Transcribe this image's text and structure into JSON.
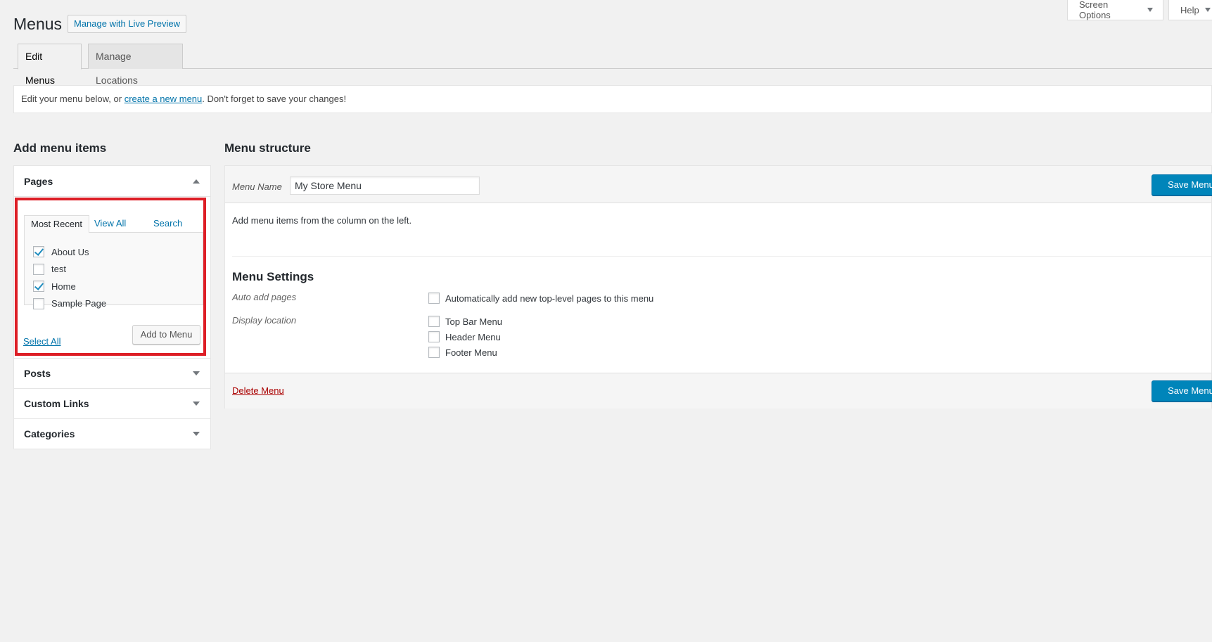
{
  "header": {
    "title": "Menus",
    "live_preview_label": "Manage with Live Preview",
    "screen_options_label": "Screen Options",
    "help_label": "Help"
  },
  "tabs": [
    {
      "label": "Edit Menus",
      "active": true
    },
    {
      "label": "Manage Locations",
      "active": false
    }
  ],
  "notice": {
    "prefix": "Edit your menu below, or ",
    "link": "create a new menu",
    "suffix": ". Don't forget to save your changes!"
  },
  "add_items": {
    "title": "Add menu items",
    "sections": [
      "Pages",
      "Posts",
      "Custom Links",
      "Categories"
    ],
    "pages": {
      "sub_tabs": [
        "Most Recent",
        "View All",
        "Search"
      ],
      "items": [
        {
          "label": "About Us",
          "checked": true
        },
        {
          "label": "test",
          "checked": false
        },
        {
          "label": "Home",
          "checked": true
        },
        {
          "label": "Sample Page",
          "checked": false
        }
      ],
      "select_all": "Select All",
      "add_button": "Add to Menu"
    }
  },
  "structure": {
    "title": "Menu structure",
    "menu_name_label": "Menu Name",
    "menu_name_value": "My Store Menu",
    "save_label": "Save Menu",
    "hint": "Add menu items from the column on the left.",
    "settings_title": "Menu Settings",
    "auto_add_label": "Auto add pages",
    "auto_add_option": "Automatically add new top-level pages to this menu",
    "display_location_label": "Display location",
    "locations": [
      "Top Bar Menu",
      "Header Menu",
      "Footer Menu"
    ],
    "delete_label": "Delete Menu"
  },
  "colors": {
    "primary": "#0085ba",
    "link": "#0073aa",
    "highlight": "#dd1e26",
    "delete": "#aa0000"
  }
}
